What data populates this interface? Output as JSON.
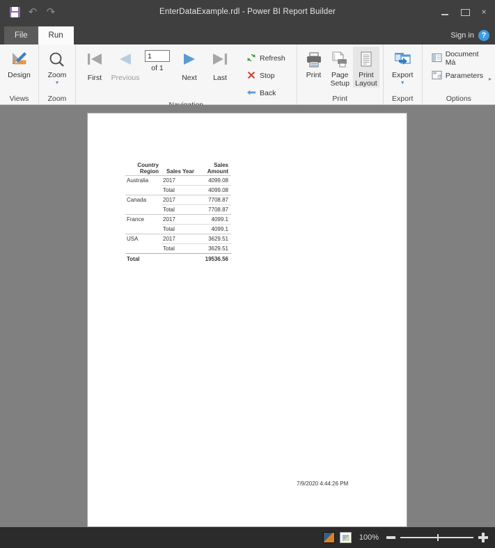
{
  "titlebar": {
    "title": "EnterDataExample.rdl - Power BI Report Builder",
    "quick_access": [
      {
        "name": "save-icon",
        "label": "Save"
      },
      {
        "name": "undo-icon",
        "label": "↶"
      },
      {
        "name": "redo-icon",
        "label": "↷"
      }
    ],
    "window_buttons": {
      "minimize": "",
      "restore": "",
      "close": "×"
    }
  },
  "tabs": [
    {
      "label": "File",
      "active": false
    },
    {
      "label": "Run",
      "active": true
    }
  ],
  "account": {
    "signin_label": "Sign in",
    "help_label": "?"
  },
  "ribbon": {
    "groups": [
      {
        "name": "views",
        "label": "Views",
        "buttons": [
          {
            "label": "Design",
            "icon": "design-icon"
          }
        ]
      },
      {
        "name": "zoom",
        "label": "Zoom",
        "buttons": [
          {
            "label": "Zoom",
            "icon": "magnifier-icon",
            "caret": "▼"
          }
        ]
      },
      {
        "name": "navigation",
        "label": "Navigation",
        "buttons": [
          {
            "label": "First",
            "icon": "first-page-icon",
            "enabled": true
          },
          {
            "label": "Previous",
            "icon": "previous-page-icon",
            "enabled": false
          },
          {
            "label": "Next",
            "icon": "next-page-icon",
            "enabled": true
          },
          {
            "label": "Last",
            "icon": "last-page-icon",
            "enabled": true
          }
        ],
        "page_input": {
          "value": "1",
          "of_label": "of  1"
        },
        "commands": [
          {
            "label": "Refresh",
            "icon": "refresh-icon"
          },
          {
            "label": "Stop",
            "icon": "stop-icon"
          },
          {
            "label": "Back",
            "icon": "back-icon"
          }
        ]
      },
      {
        "name": "print",
        "label": "Print",
        "buttons": [
          {
            "label": "Print",
            "icon": "printer-icon"
          },
          {
            "label": "Page Setup",
            "icon": "page-setup-icon"
          },
          {
            "label": "Print Layout",
            "icon": "print-layout-icon",
            "active": true
          }
        ]
      },
      {
        "name": "export",
        "label": "Export",
        "buttons": [
          {
            "label": "Export",
            "icon": "export-icon",
            "caret": "▼"
          }
        ]
      },
      {
        "name": "options",
        "label": "Options",
        "commands": [
          {
            "label": "Document Mà",
            "icon": "document-map-icon"
          },
          {
            "label": "Parameters",
            "icon": "parameters-icon"
          }
        ],
        "expand": "▸"
      }
    ]
  },
  "report": {
    "table": {
      "headers": [
        "Country Region",
        "Sales Year",
        "Sales Amount"
      ],
      "header_lines": {
        "country": [
          "Country",
          "Region"
        ],
        "year": [
          "Sales Year"
        ],
        "amount": [
          "Sales",
          "Amount"
        ]
      },
      "groups": [
        {
          "country": "Australia",
          "year": "2017",
          "amount": "4099.08",
          "subtotal_label": "Total",
          "subtotal": "4099.08"
        },
        {
          "country": "Canada",
          "year": "2017",
          "amount": "7708.87",
          "subtotal_label": "Total",
          "subtotal": "7708.87"
        },
        {
          "country": "France",
          "year": "2017",
          "amount": "4099.1",
          "subtotal_label": "Total",
          "subtotal": "4099.1"
        },
        {
          "country": "USA",
          "year": "2017",
          "amount": "3629.51",
          "subtotal_label": "Total",
          "subtotal": "3629.51"
        }
      ],
      "grand_total_label": "Total",
      "grand_total": "19536.56"
    },
    "timestamp": "7/9/2020 4:44:26 PM"
  },
  "statusbar": {
    "view_icons": [
      "print-preview-icon",
      "page-view-icon"
    ],
    "zoom_label": "100%",
    "zoom_out": "−",
    "zoom_in": "+"
  },
  "colors": {
    "chrome": "#3f3f3f",
    "ribbon": "#f6f6f6",
    "canvas": "#808080",
    "accent": "#3f9ae0",
    "save": "#8a6aa8"
  }
}
